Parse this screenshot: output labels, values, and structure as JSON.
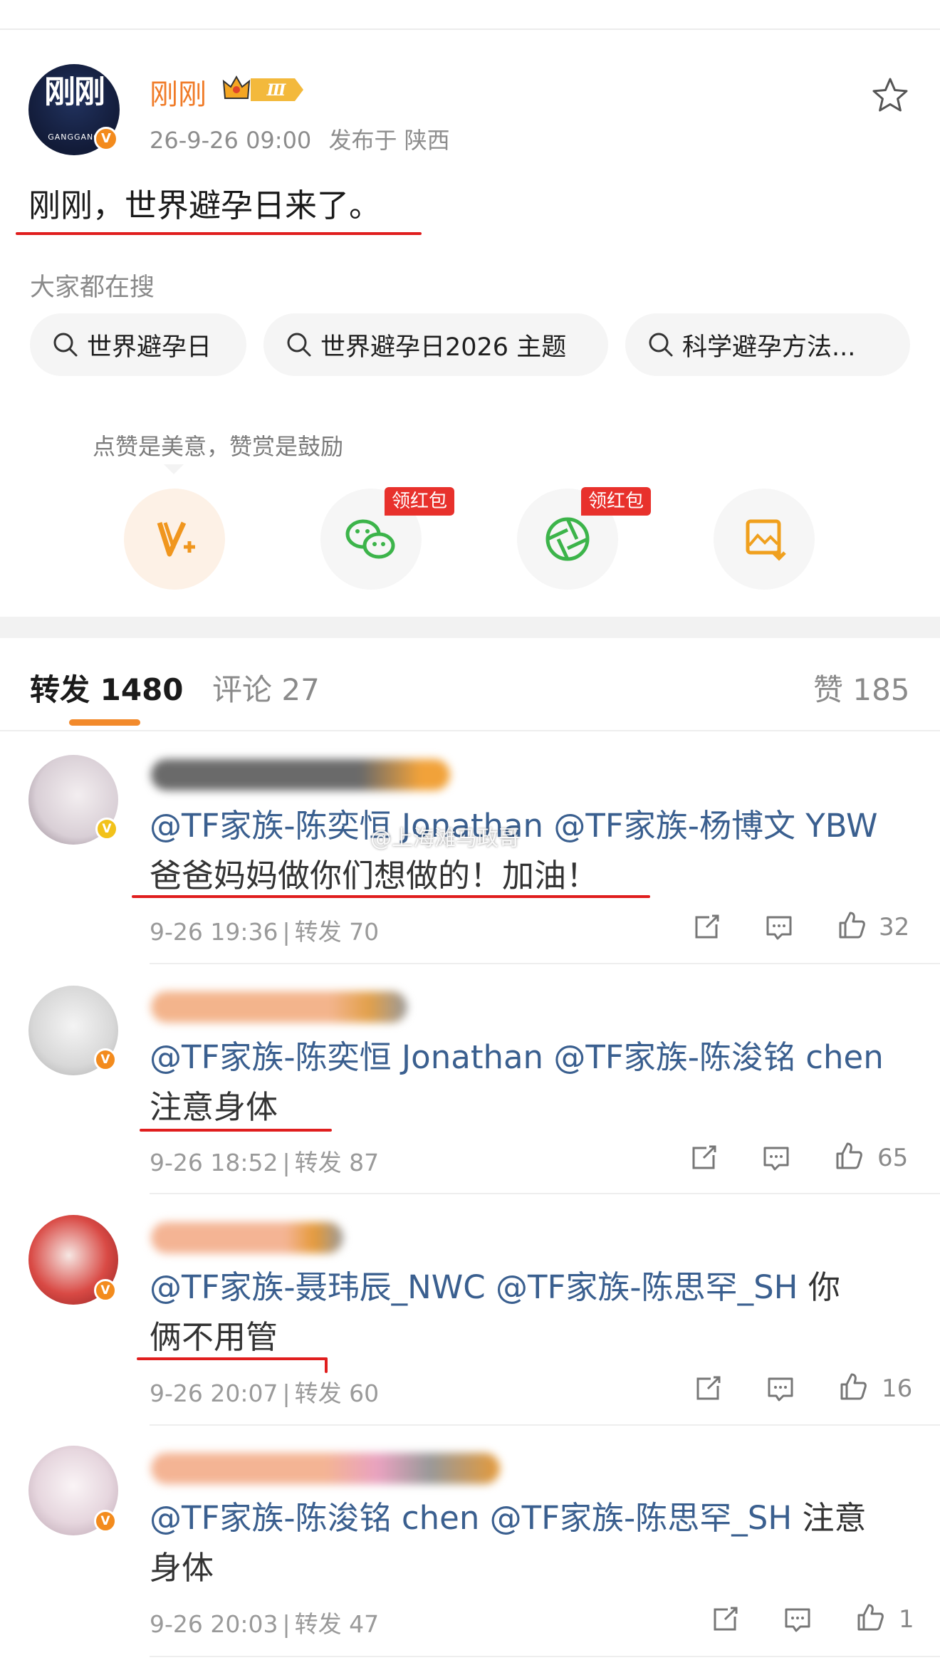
{
  "post": {
    "author": "刚刚",
    "level_badge": "Ⅲ",
    "avatar_text": "刚刚",
    "avatar_sub": "GANGGANG",
    "verified_badge": "V",
    "time": "26-9-26 09:00",
    "location": "发布于 陕西",
    "text": "刚刚，世界避孕日来了。"
  },
  "search": {
    "title": "大家都在搜",
    "chips": [
      "世界避孕日",
      "世界避孕日2026 主题",
      "科学避孕方法..."
    ]
  },
  "reward": {
    "tip": "点赞是美意，赞赏是鼓励",
    "red_packet_label": "领红包",
    "buttons": [
      {
        "icon": "reward-v-plus-icon"
      },
      {
        "icon": "wechat-icon",
        "tag": "领红包"
      },
      {
        "icon": "moments-icon",
        "tag": "领红包"
      },
      {
        "icon": "save-image-icon"
      }
    ]
  },
  "tabs": {
    "repost": "转发 1480",
    "comment": "评论 27",
    "like": "赞 185"
  },
  "watermark": "@上海滩马政哥",
  "comments": [
    {
      "mentions": "@TF家族-陈奕恒 Jonathan @TF家族-杨博文 YBW",
      "text": "爸爸妈妈做你们想做的！加油！",
      "time": "9-26 19:36",
      "repost": "转发 70",
      "likes": "32"
    },
    {
      "mentions": "@TF家族-陈奕恒 Jonathan @TF家族-陈浚铭 chen",
      "text": "注意身体",
      "time": "9-26 18:52",
      "repost": "转发 87",
      "likes": "65"
    },
    {
      "mentions": "@TF家族-聂玮辰_NWC @TF家族-陈思罕_SH",
      "text_tail": "你",
      "text": "俩不用管",
      "time": "9-26 20:07",
      "repost": "转发 60",
      "likes": "16"
    },
    {
      "mentions": "@TF家族-陈浚铭 chen @TF家族-陈思罕_SH",
      "text_tail": "注意",
      "text": "身体",
      "time": "9-26 20:03",
      "repost": "转发 47",
      "likes": "1"
    }
  ],
  "colors": {
    "accent_orange": "#f07b28",
    "underline_red": "#e01e1e",
    "mention_blue": "#3a5f8f",
    "tab_indicator": "#f28a2c"
  }
}
